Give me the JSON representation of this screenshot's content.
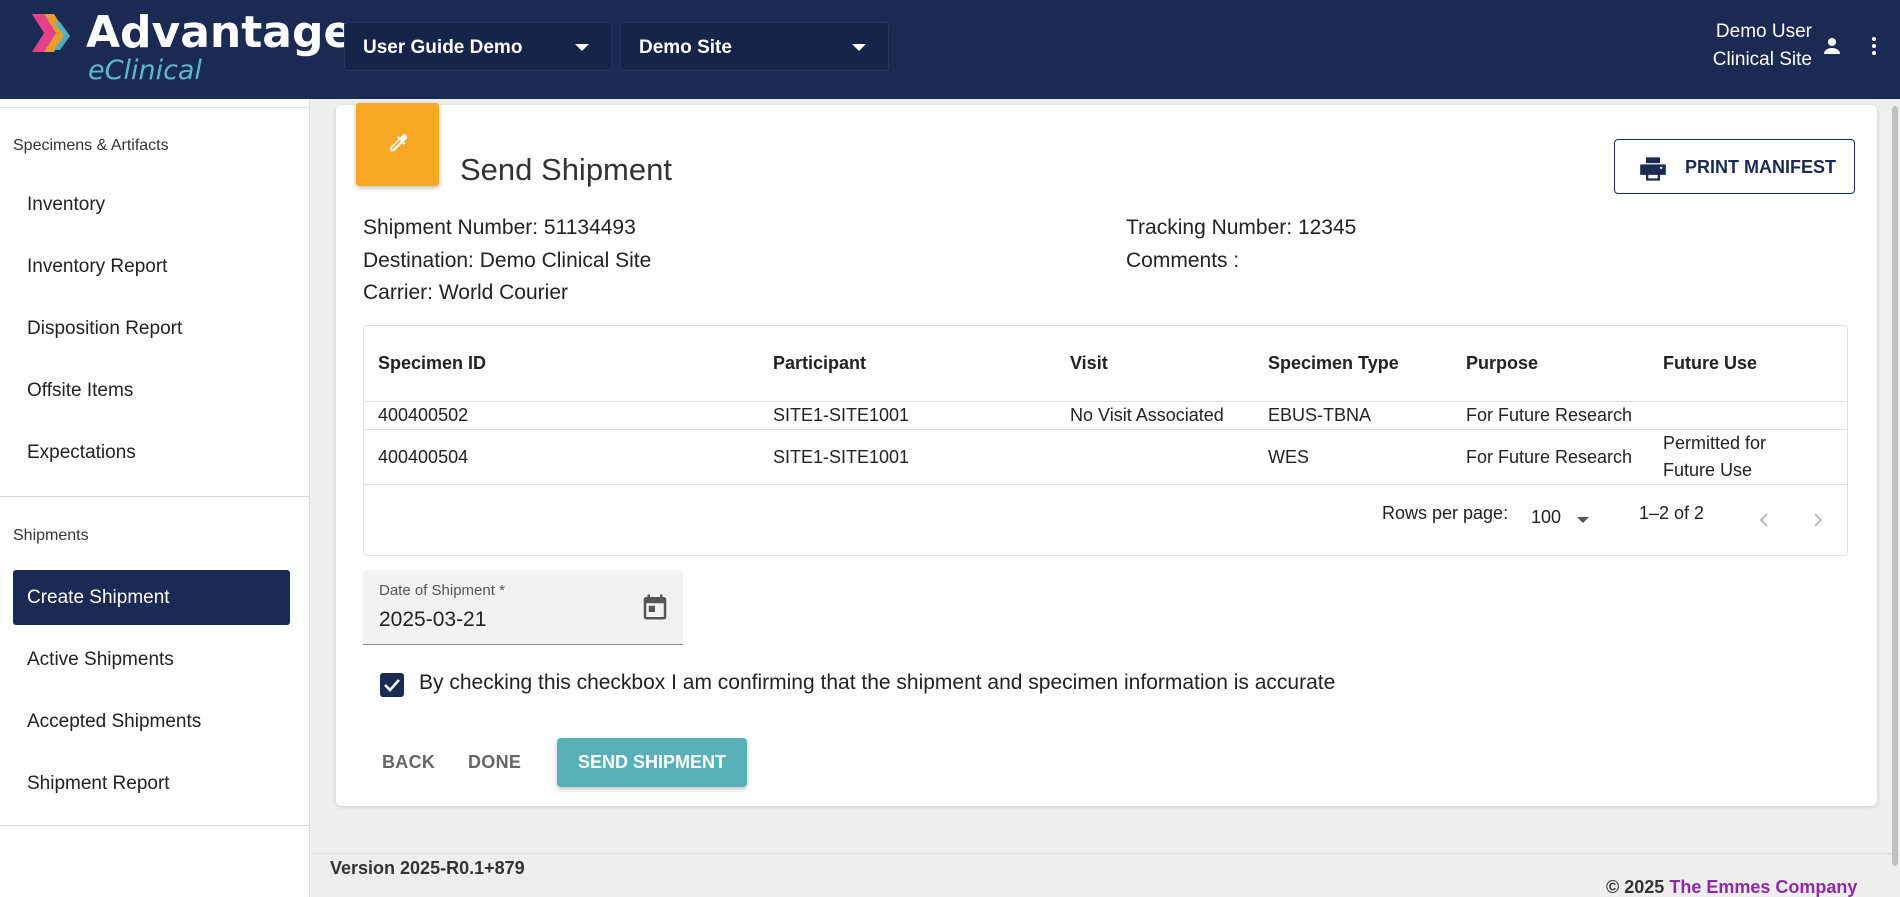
{
  "header": {
    "logo_title": "Advantage",
    "logo_subtitle": "eClinical",
    "study_selector": "User Guide Demo",
    "site_selector": "Demo Site",
    "user_name": "Demo User",
    "user_role": "Clinical Site",
    "brand_color": "#1b2a52"
  },
  "sidebar": {
    "sections": [
      {
        "label": "Specimens & Artifacts",
        "items": [
          "Inventory",
          "Inventory Report",
          "Disposition Report",
          "Offsite Items",
          "Expectations"
        ]
      },
      {
        "label": "Shipments",
        "items": [
          "Create Shipment",
          "Active Shipments",
          "Accepted Shipments",
          "Shipment Report"
        ]
      }
    ],
    "active_item": "Create Shipment"
  },
  "main": {
    "title": "Send Shipment",
    "tile_icon": "eyedropper-icon",
    "print_button": "PRINT MANIFEST",
    "info": {
      "shipment_number": "Shipment Number: 51134493",
      "destination": "Destination: Demo Clinical Site",
      "carrier": "Carrier: World Courier",
      "tracking_number": "Tracking Number: 12345",
      "comments": "Comments :"
    },
    "table": {
      "columns": [
        "Specimen ID",
        "Participant",
        "Visit",
        "Specimen Type",
        "Purpose",
        "Future Use"
      ],
      "rows": [
        [
          "400400502",
          "SITE1-SITE1001",
          "No Visit Associated",
          "EBUS-TBNA",
          "For Future Research",
          ""
        ],
        [
          "400400504",
          "SITE1-SITE1001",
          "",
          "WES",
          "For Future Research",
          "Permitted for Future Use"
        ]
      ],
      "pagination": {
        "rows_per_page_label": "Rows per page:",
        "rows_per_page": "100",
        "range": "1–2 of 2"
      }
    },
    "date_field": {
      "label": "Date of Shipment *",
      "value": "2025-03-21"
    },
    "confirm_checkbox": {
      "checked": true,
      "label": "By checking this checkbox I am confirming that the shipment and specimen information is accurate"
    },
    "buttons": {
      "back": "BACK",
      "done": "DONE",
      "send": "SEND SHIPMENT"
    },
    "accent_color": "#58b0b8",
    "tile_color": "#f9a825"
  },
  "footer": {
    "version": "Version 2025-R0.1+879",
    "copyright_prefix": "© 2025",
    "company": "The Emmes Company"
  }
}
